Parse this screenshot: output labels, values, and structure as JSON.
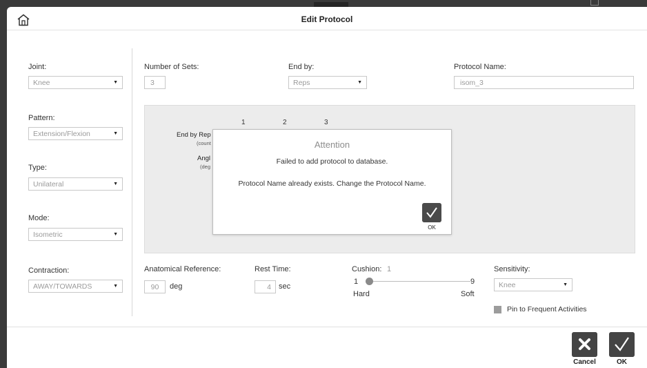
{
  "window": {
    "title": "Edit Protocol"
  },
  "left": {
    "joint": {
      "label": "Joint:",
      "value": "Knee"
    },
    "pattern": {
      "label": "Pattern:",
      "value": "Extension/Flexion"
    },
    "type": {
      "label": "Type:",
      "value": "Unilateral"
    },
    "mode": {
      "label": "Mode:",
      "value": "Isometric"
    },
    "contraction": {
      "label": "Contraction:",
      "value": "AWAY/TOWARDS"
    }
  },
  "top": {
    "sets": {
      "label": "Number of Sets:",
      "value": "3"
    },
    "end_by": {
      "label": "End by:",
      "value": "Reps"
    },
    "protocol_name": {
      "label": "Protocol Name:",
      "value": "isom_3"
    }
  },
  "sets_panel": {
    "set_numbers": [
      "1",
      "2",
      "3"
    ],
    "end_by_reps_label": "End by Rep",
    "end_by_reps_sub": "(count",
    "angle_label": "Angl",
    "angle_sub": "(deg"
  },
  "dialog": {
    "title": "Attention",
    "message1": "Failed to add protocol to database.",
    "message2": "Protocol Name already exists. Change the Protocol Name.",
    "ok_label": "OK"
  },
  "bottom": {
    "anatomical": {
      "label": "Anatomical Reference:",
      "value": "90",
      "unit": "deg"
    },
    "rest": {
      "label": "Rest Time:",
      "value": "4",
      "unit": "sec"
    },
    "cushion": {
      "label": "Cushion:",
      "value": "1",
      "min": "1",
      "max": "9",
      "min_label": "Hard",
      "max_label": "Soft"
    },
    "sensitivity": {
      "label": "Sensitivity:",
      "value": "Knee"
    },
    "pin": {
      "label": "Pin to Frequent Activities"
    }
  },
  "footer": {
    "cancel_label": "Cancel",
    "ok_label": "OK"
  },
  "colors": {
    "button": "#444444",
    "panel": "#ececec"
  }
}
